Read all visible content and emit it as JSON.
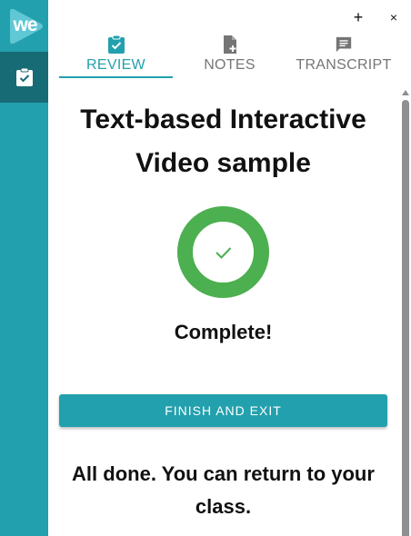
{
  "rail": {
    "logo_text": "we",
    "active_item_icon": "clipboard-check-icon"
  },
  "window": {
    "add_symbol": "+",
    "close_symbol": "×"
  },
  "tabs": [
    {
      "label": "REVIEW",
      "icon": "clipboard-check-icon",
      "active": true
    },
    {
      "label": "NOTES",
      "icon": "file-add-icon",
      "active": false
    },
    {
      "label": "TRANSCRIPT",
      "icon": "message-lines-icon",
      "active": false
    }
  ],
  "main": {
    "title": "Text-based Interactive Video sample",
    "progress_complete": 1.0,
    "status": "Complete!",
    "finish_button": "FINISH AND EXIT",
    "done_message": "All done. You can return to your class."
  },
  "colors": {
    "accent": "#23a0ae",
    "rail_active": "#176b74",
    "success": "#4caf50",
    "tab_inactive": "#757575",
    "scrollbar": "#8f8f8f"
  }
}
